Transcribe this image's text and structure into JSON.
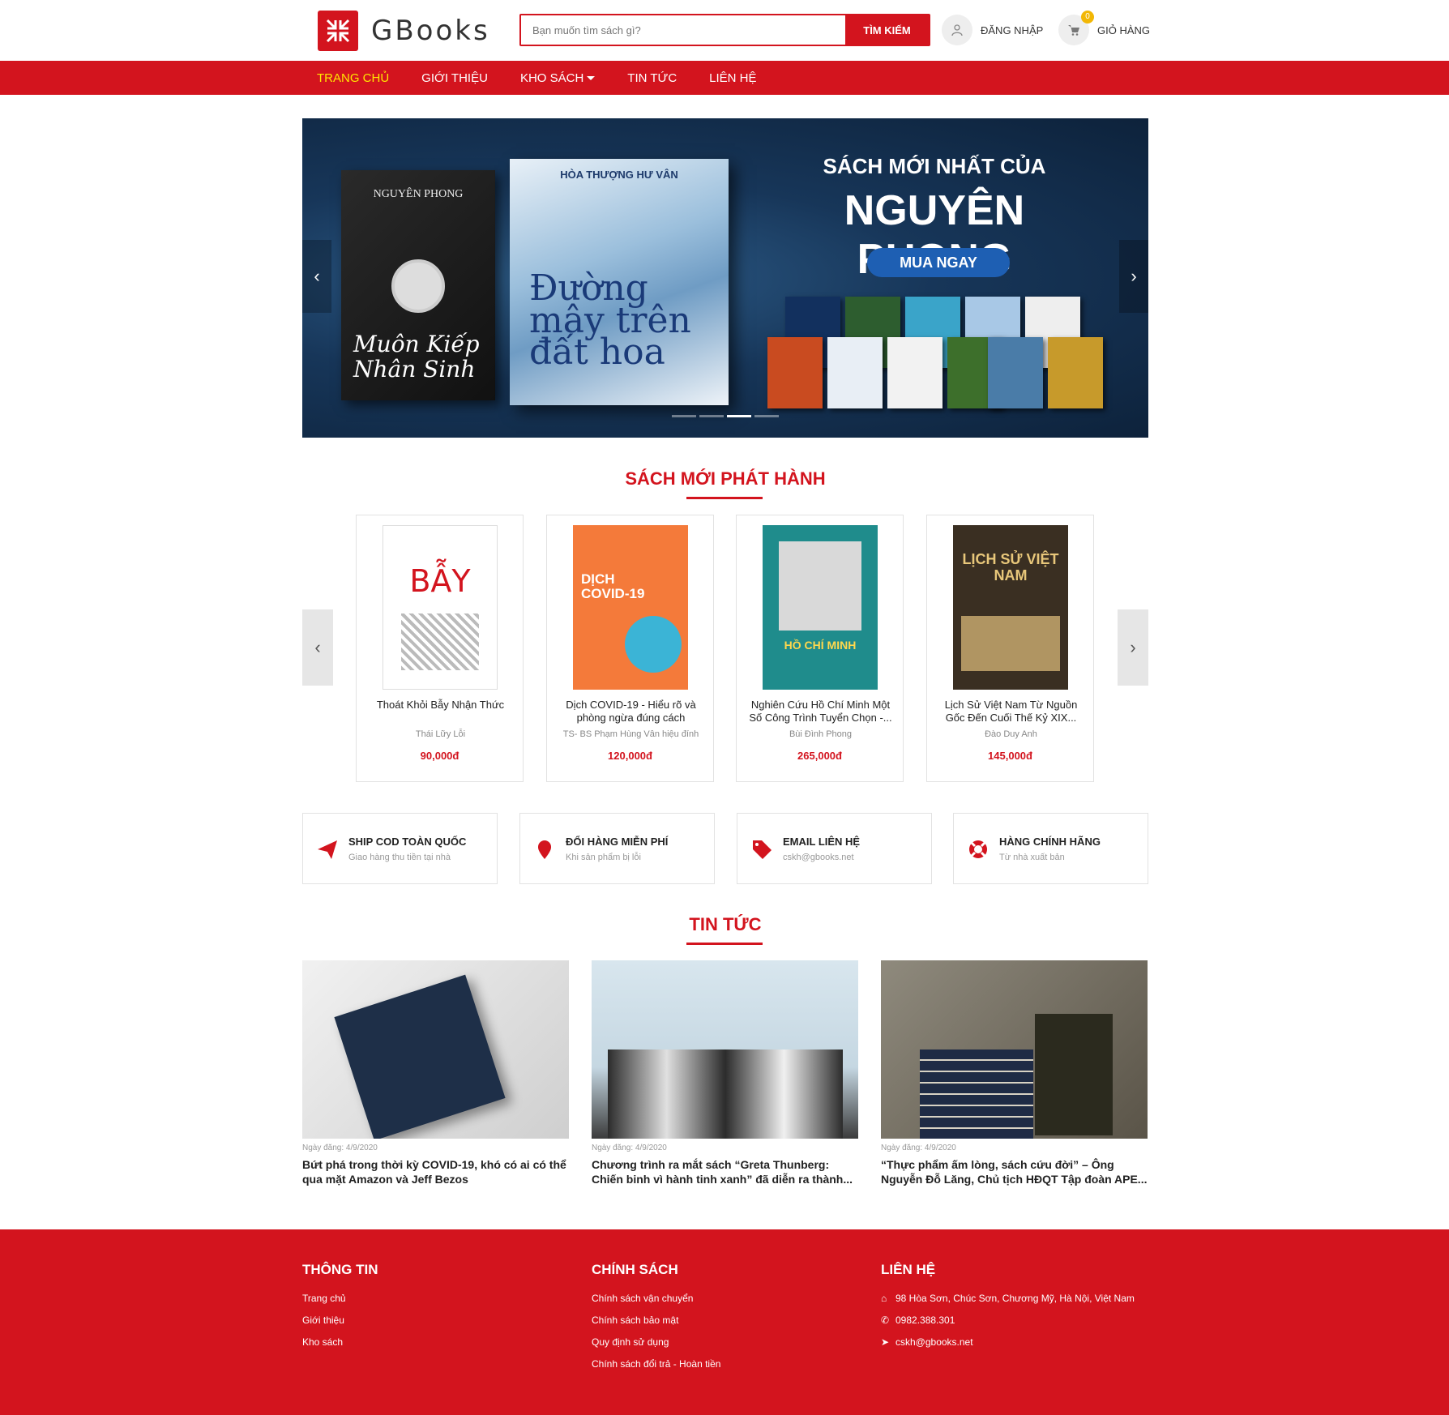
{
  "header": {
    "logo_text": "GBooks",
    "search_placeholder": "Bạn muốn tìm sách gì?",
    "search_button": "TÌM KIẾM",
    "login_label": "ĐĂNG NHẬP",
    "cart_label": "GIỎ HÀNG",
    "cart_count": "0"
  },
  "nav": {
    "items": [
      {
        "label": "TRANG CHỦ",
        "active": true
      },
      {
        "label": "GIỚI THIỆU"
      },
      {
        "label": "KHO SÁCH"
      },
      {
        "label": "TIN TỨC"
      },
      {
        "label": "LIÊN HỆ"
      }
    ]
  },
  "banner": {
    "headline_1": "SÁCH MỚI NHẤT CỦA",
    "headline_2": "NGUYÊN PHONG",
    "cta": "MUA NGAY",
    "book_a_author": "NGUYÊN PHONG",
    "book_a_title": "Muôn Kiếp Nhân Sinh",
    "book_b_author": "HÒA THƯỢNG HƯ VÂN",
    "book_b_title": "Đường mây trên đất hoa",
    "slide_count": 4,
    "active_slide": 3
  },
  "new_books": {
    "title": "SÁCH MỚI PHÁT HÀNH",
    "items": [
      {
        "name": "Thoát Khỏi Bẫy Nhận Thức",
        "author": "Thái Lữy Lỗi",
        "price": "90,000đ",
        "cover_text": "BẪY"
      },
      {
        "name": "Dịch COVID-19 - Hiểu rõ và phòng ngừa đúng cách",
        "author": "TS- BS Phạm Hùng Vân hiệu đính",
        "price": "120,000đ",
        "cover_text": "DỊCH COVID-19"
      },
      {
        "name": "Nghiên Cứu Hồ Chí Minh Một Số Công Trình Tuyển Chọn -...",
        "author": "Bùi Đình Phong",
        "price": "265,000đ",
        "cover_text": "HỒ CHÍ MINH"
      },
      {
        "name": "Lịch Sử Việt Nam Từ Nguồn Gốc Đến Cuối Thế Kỷ XIX...",
        "author": "Đào Duy Anh",
        "price": "145,000đ",
        "cover_text": "LỊCH SỬ VIỆT NAM"
      }
    ]
  },
  "features": [
    {
      "title": "SHIP COD TOÀN QUỐC",
      "sub": "Giao hàng thu tiền tại nhà",
      "icon": "paper-plane-icon"
    },
    {
      "title": "ĐỔI HÀNG MIỄN PHÍ",
      "sub": "Khi sản phẩm bị lỗi",
      "icon": "map-pin-icon"
    },
    {
      "title": "EMAIL LIÊN HỆ",
      "sub": "cskh@gbooks.net",
      "icon": "tag-icon"
    },
    {
      "title": "HÀNG CHÍNH HÃNG",
      "sub": "Từ nhà xuất bản",
      "icon": "lifebuoy-icon"
    }
  ],
  "news": {
    "title": "TIN TỨC",
    "items": [
      {
        "date": "Ngày đăng: 4/9/2020",
        "title": "Bứt phá trong thời kỳ COVID-19, khó có ai có thể qua mặt Amazon và Jeff Bezos"
      },
      {
        "date": "Ngày đăng: 4/9/2020",
        "title": "Chương trình ra mắt sách “Greta Thunberg: Chiến binh vì hành tinh xanh” đã diễn ra thành..."
      },
      {
        "date": "Ngày đăng: 4/9/2020",
        "title": "“Thực phẩm ấm lòng, sách cứu đời” – Ông Nguyễn Đỗ Lăng, Chủ tịch HĐQT Tập đoàn APE..."
      }
    ]
  },
  "footer": {
    "info": {
      "title": "THÔNG TIN",
      "links": [
        "Trang chủ",
        "Giới thiệu",
        "Kho sách"
      ]
    },
    "policy": {
      "title": "CHÍNH SÁCH",
      "links": [
        "Chính sách vận chuyển",
        "Chính sách bảo mật",
        "Quy định sử dụng",
        "Chính sách đổi trả - Hoàn tiền"
      ]
    },
    "contact": {
      "title": "LIÊN HỆ",
      "address": "98 Hòa Sơn, Chúc Sơn, Chương Mỹ, Hà Nội, Việt Nam",
      "phone": "0982.388.301",
      "email": "cskh@gbooks.net"
    }
  },
  "colors": {
    "brand": "#d3141e",
    "nav_active": "#ffe600",
    "badge": "#f2b705"
  }
}
